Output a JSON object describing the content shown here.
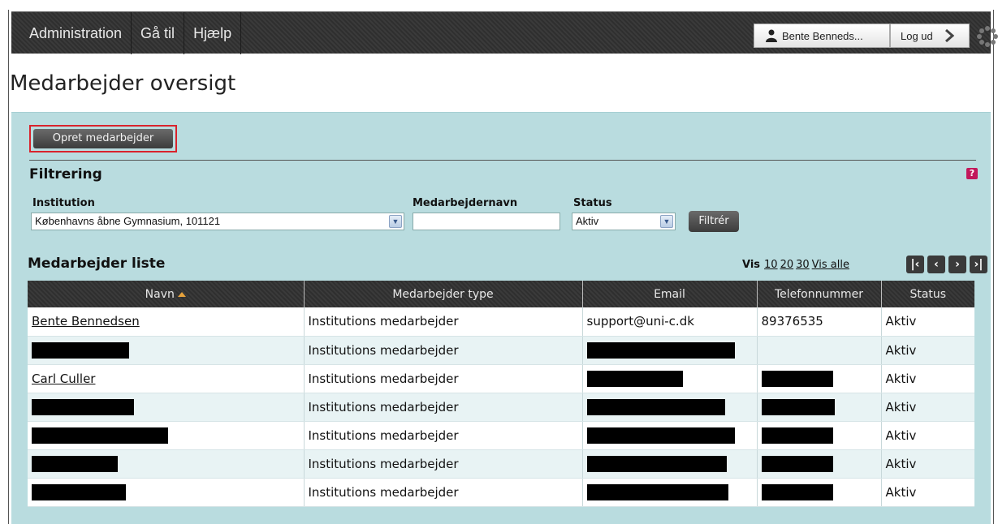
{
  "menu": [
    "Administration",
    "Gå til",
    "Hjælp"
  ],
  "user": {
    "name": "Bente Benneds...",
    "logout_label": "Log ud"
  },
  "page_title": "Medarbejder oversigt",
  "create_button": "Opret medarbejder",
  "filter": {
    "heading": "Filtrering",
    "help_label": "?",
    "institution_label": "Institution",
    "institution_value": "Københavns åbne Gymnasium, 101121",
    "name_label": "Medarbejdernavn",
    "name_value": "",
    "status_label": "Status",
    "status_value": "Aktiv",
    "submit_label": "Filtrér"
  },
  "list": {
    "heading": "Medarbejder liste",
    "vis_label": "Vis",
    "page_sizes": [
      "10",
      "20",
      "30",
      "Vis alle"
    ],
    "pager_icons": [
      "first-page-icon",
      "previous-page-icon",
      "next-page-icon",
      "last-page-icon"
    ],
    "columns": [
      "Navn",
      "Medarbejder type",
      "Email",
      "Telefonnummer",
      "Status"
    ],
    "rows": [
      {
        "name": "Bente Bennedsen",
        "type": "Institutions medarbejder",
        "email": "support@uni-c.dk",
        "phone": "89376535",
        "status": "Aktiv"
      },
      {
        "name": "",
        "type": "Institutions medarbejder",
        "email": "",
        "phone": "",
        "status": "Aktiv"
      },
      {
        "name": "Carl Culler",
        "type": "Institutions medarbejder",
        "email": "",
        "phone": "",
        "status": "Aktiv"
      },
      {
        "name": "",
        "type": "Institutions medarbejder",
        "email": "",
        "phone": "",
        "status": "Aktiv"
      },
      {
        "name": "",
        "type": "Institutions medarbejder",
        "email": "",
        "phone": "",
        "status": "Aktiv"
      },
      {
        "name": "",
        "type": "Institutions medarbejder",
        "email": "",
        "phone": "",
        "status": "Aktiv"
      },
      {
        "name": "",
        "type": "Institutions medarbejder",
        "email": "",
        "phone": "",
        "status": "Aktiv"
      }
    ]
  },
  "colors": {
    "panel": "#b9dcdf",
    "highlight_border": "#d9232c",
    "help": "#c2185b",
    "sort_arrow": "#e6a23c"
  }
}
